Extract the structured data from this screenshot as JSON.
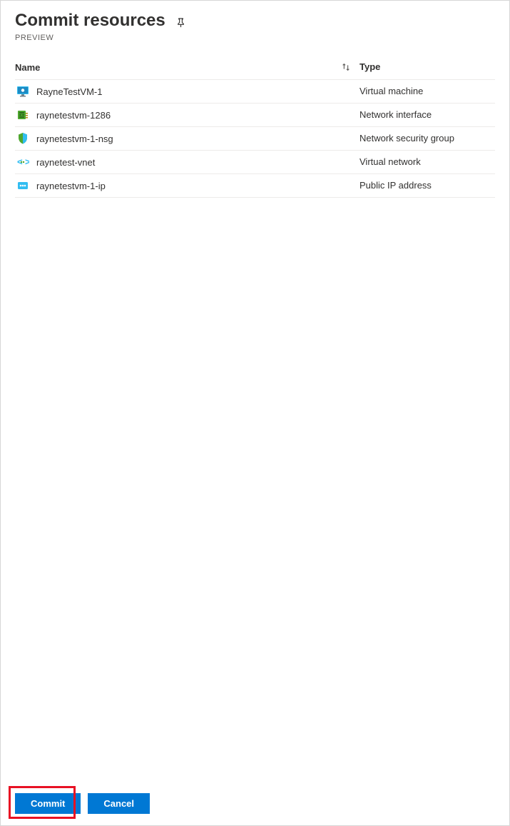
{
  "header": {
    "title": "Commit resources",
    "preview_label": "PREVIEW"
  },
  "table": {
    "name_header": "Name",
    "type_header": "Type",
    "rows": [
      {
        "name": "RayneTestVM-1",
        "type": "Virtual machine",
        "icon": "vm"
      },
      {
        "name": "raynetestvm-1286",
        "type": "Network interface",
        "icon": "nic"
      },
      {
        "name": "raynetestvm-1-nsg",
        "type": "Network security group",
        "icon": "nsg"
      },
      {
        "name": "raynetest-vnet",
        "type": "Virtual network",
        "icon": "vnet"
      },
      {
        "name": "raynetestvm-1-ip",
        "type": "Public IP address",
        "icon": "ip"
      }
    ]
  },
  "footer": {
    "commit_label": "Commit",
    "cancel_label": "Cancel"
  }
}
